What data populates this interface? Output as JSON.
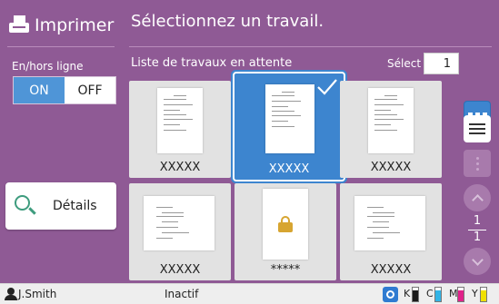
{
  "header": {
    "app_title": "Imprimer",
    "prompt": "Sélectionnez un travail."
  },
  "left_panel": {
    "online_label": "En/hors ligne",
    "on_label": "ON",
    "off_label": "OFF",
    "details_label": "Détails",
    "online_state": "ON"
  },
  "main": {
    "list_label": "Liste de travaux en attente",
    "select_label": "Sélect",
    "select_count": "1",
    "jobs": [
      {
        "name": "XXXXX",
        "orientation": "portrait",
        "selected": false,
        "locked": false
      },
      {
        "name": "XXXXX",
        "orientation": "portrait",
        "selected": true,
        "locked": false
      },
      {
        "name": "XXXXX",
        "orientation": "portrait",
        "selected": false,
        "locked": false
      },
      {
        "name": "XXXXX",
        "orientation": "landscape",
        "selected": false,
        "locked": false
      },
      {
        "name": "*****",
        "orientation": "portrait",
        "selected": false,
        "locked": true
      },
      {
        "name": "XXXXX",
        "orientation": "landscape",
        "selected": false,
        "locked": false
      }
    ],
    "pager": {
      "current": "1",
      "total": "1"
    }
  },
  "controls": {
    "icons": [
      "grid-view-icon",
      "list-view-icon",
      "more-options-icon",
      "scroll-up-icon",
      "scroll-down-icon"
    ]
  },
  "status_bar": {
    "user": "J.Smith",
    "status": "Inactif",
    "ink": [
      {
        "label": "K",
        "color": "#1a1a1a",
        "level": 0.8
      },
      {
        "label": "C",
        "color": "#32b4e6",
        "level": 0.8
      },
      {
        "label": "M",
        "color": "#e0228a",
        "level": 0.8
      },
      {
        "label": "Y",
        "color": "#f0e000",
        "level": 0.8
      }
    ]
  },
  "colors": {
    "panel": "#8f5a95",
    "accent": "#3d85cf",
    "tile": "#e2e2e2"
  }
}
